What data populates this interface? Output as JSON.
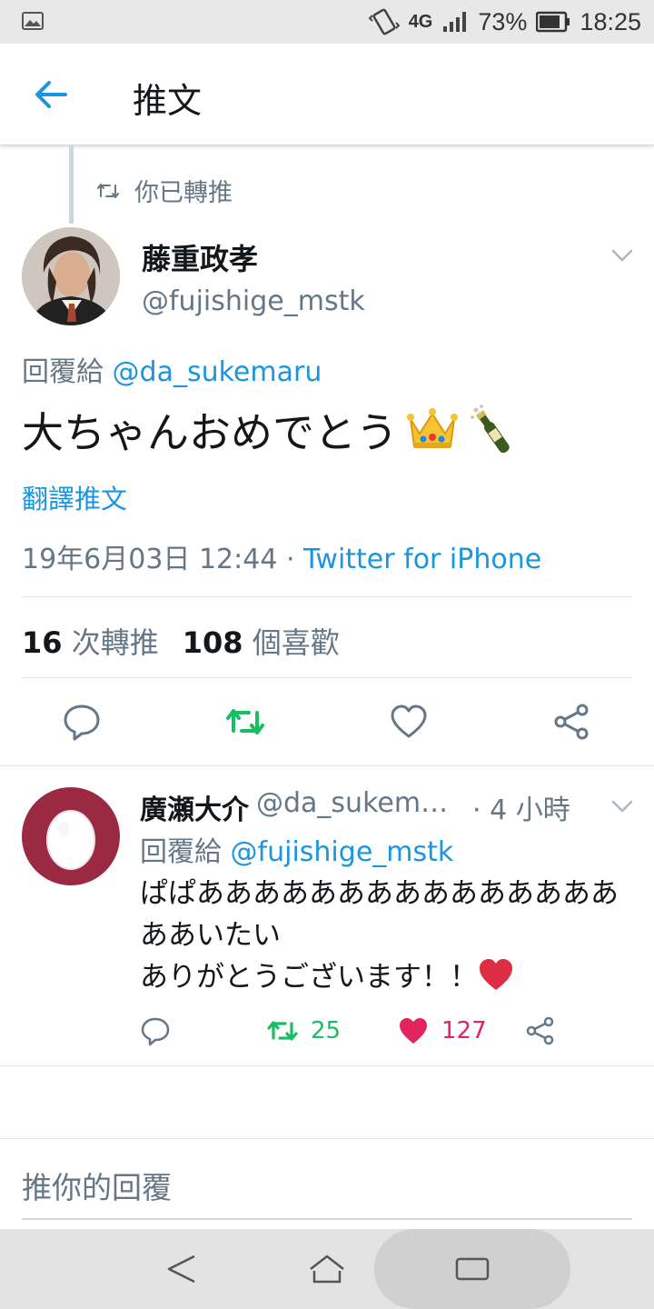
{
  "status_bar": {
    "network": "4G",
    "battery": "73%",
    "time": "18:25"
  },
  "header": {
    "title": "推文"
  },
  "retweet_context": {
    "label": "你已轉推"
  },
  "main_tweet": {
    "name": "藤重政孝",
    "handle": "@fujishige_mstk",
    "reply_to_label": "回覆給",
    "reply_to_handle": "@da_sukemaru",
    "text": "大ちゃんおめでとう",
    "emojis": [
      "crown-emoji",
      "champagne-emoji"
    ],
    "translate_label": "翻譯推文",
    "timestamp": "19年6月03日 12:44 · ",
    "source": "Twitter for iPhone",
    "retweet_count": "16",
    "retweet_label": "次轉推",
    "like_count": "108",
    "like_label": "個喜歡"
  },
  "reply_tweet": {
    "name": "廣瀬大介",
    "handle": "@da_sukemaru",
    "time": "· 4 小時",
    "reply_to_label": "回覆給",
    "reply_to_handle": "@fujishige_mstk",
    "line1": "ぱぱあああああああああああああああ",
    "line2": "ああいたい",
    "line3": "ありがとうございます！！",
    "retweet_count": "25",
    "like_count": "127"
  },
  "compose": {
    "placeholder": "推你的回覆"
  },
  "colors": {
    "accent": "#1b95e0",
    "retweet_green": "#17bf63",
    "like_red": "#e0245e",
    "muted": "#657786"
  }
}
